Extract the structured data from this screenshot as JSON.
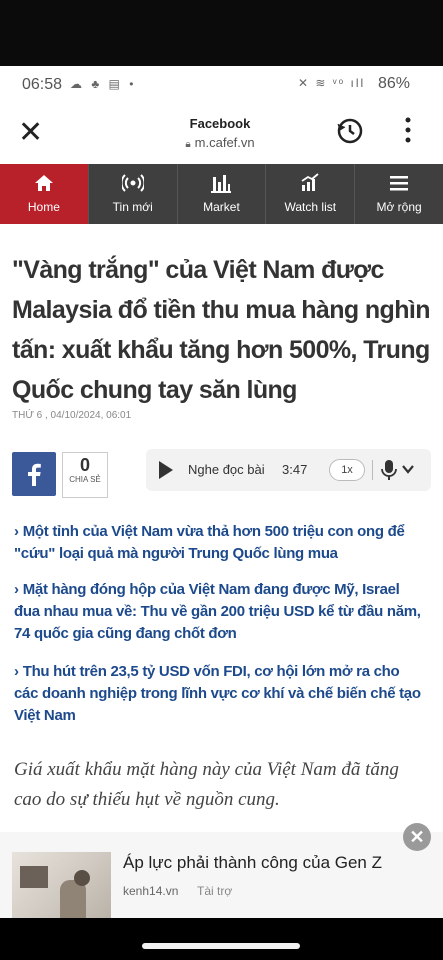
{
  "status_bar": {
    "time": "06:58",
    "battery": "86%"
  },
  "browser": {
    "title": "Facebook",
    "url": "m.cafef.vn"
  },
  "nav": {
    "items": [
      {
        "label": "Home",
        "icon": "home-icon"
      },
      {
        "label": "Tin mới",
        "icon": "broadcast-icon"
      },
      {
        "label": "Market",
        "icon": "market-chart-icon"
      },
      {
        "label": "Watch list",
        "icon": "watchlist-chart-icon"
      },
      {
        "label": "Mở rộng",
        "icon": "menu-icon"
      }
    ],
    "active_color": "#b8202a",
    "bar_color": "#3f3f3f"
  },
  "article": {
    "headline": "\"Vàng trắng\" của Việt Nam được Malaysia đổ tiền thu mua hàng nghìn tấn: xuất khẩu tăng hơn 500%, Trung Quốc chung tay săn lùng",
    "date": "THỨ 6 , 04/10/2024, 06:01",
    "share_count": "0",
    "share_label": "CHIA SẺ",
    "audio_label": "Nghe đọc bài",
    "audio_duration": "3:47",
    "audio_speed": "1x",
    "related": [
      "Một tỉnh của Việt Nam vừa thả hơn 500 triệu con ong để \"cứu\" loại quả mà người Trung Quốc lùng mua",
      "Mặt hàng đóng hộp của Việt Nam đang được Mỹ, Israel đua nhau mua về: Thu về gần 200 triệu USD kể từ đầu năm, 74 quốc gia cũng đang chốt đơn",
      "Thu hút trên 23,5 tỷ USD vốn FDI, cơ hội lớn mở ra cho các doanh nghiệp trong lĩnh vực cơ khí và chế biến chế tạo Việt Nam"
    ],
    "lead": "Giá xuất khẩu mặt hàng này của Việt Nam đã tăng cao do sự thiếu hụt về nguồn cung."
  },
  "ad": {
    "title": "Áp lực phải thành công của Gen Z",
    "source": "kenh14.vn",
    "sponsored": "Tài trợ"
  }
}
